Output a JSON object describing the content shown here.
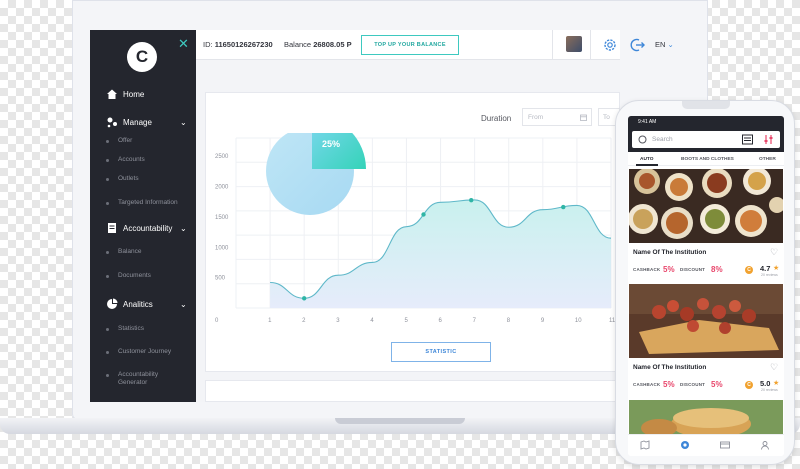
{
  "sidebar": {
    "logo_letter": "C",
    "close": "✕",
    "items": [
      {
        "label": "Home",
        "type": "main"
      },
      {
        "label": "Manage",
        "type": "main"
      },
      {
        "label": "Offer",
        "type": "sub"
      },
      {
        "label": "Accounts",
        "type": "sub"
      },
      {
        "label": "Outlets",
        "type": "sub"
      },
      {
        "label": "Targeted Information",
        "type": "sub"
      },
      {
        "label": "Accountability",
        "type": "main"
      },
      {
        "label": "Balance",
        "type": "sub"
      },
      {
        "label": "Documents",
        "type": "sub"
      },
      {
        "label": "Analitics",
        "type": "main"
      },
      {
        "label": "Statistics",
        "type": "sub"
      },
      {
        "label": "Customer Journey",
        "type": "sub"
      },
      {
        "label": "Accountability Generator",
        "type": "sub"
      }
    ]
  },
  "topbar": {
    "id_label": "ID:",
    "id_value": "11650126267230",
    "balance_label": "Balance",
    "balance_value": "26808.05 P",
    "topup_label": "TOP UP YOUR BALANCE",
    "language": "EN"
  },
  "filters": {
    "duration_label": "Duration",
    "from_placeholder": "From",
    "to_placeholder": "To"
  },
  "statistic_button": "STATISTIC",
  "chart_data": {
    "type": "area",
    "x": [
      1,
      2,
      3,
      4,
      5,
      6,
      7,
      8,
      9,
      10,
      11
    ],
    "x_ticks": [
      "0",
      "1",
      "2",
      "3",
      "4",
      "5",
      "6",
      "7",
      "8",
      "9",
      "10",
      "11"
    ],
    "y_ticks": [
      "500",
      "1000",
      "1500",
      "2000",
      "2500"
    ],
    "values": [
      420,
      160,
      540,
      750,
      1340,
      1740,
      1780,
      1330,
      1620,
      1690,
      1150
    ],
    "highlighted_points": [
      2,
      5.5,
      6.9,
      9.6
    ],
    "ylim": [
      0,
      2800
    ],
    "pie": {
      "label": "25%",
      "value": 25
    },
    "colors": {
      "line": "#5fb8c9",
      "fill_top": "#c9f1ee",
      "fill_bottom": "#e6ecfb",
      "pie_main": "#a7d9f2",
      "pie_slice": "#34d3b8"
    }
  },
  "phone": {
    "time": "9:41 AM",
    "search_placeholder": "Search",
    "tabs": [
      "AUTO",
      "BOOTS AND CLOTHES",
      "OTHER"
    ],
    "listings": [
      {
        "name": "Name Of The Institution",
        "cashback_label": "CASHBACK",
        "cashback": "5%",
        "discount_label": "DISCOUNT",
        "discount": "8%",
        "rating": "4.7",
        "badge": "C",
        "reviews": "20 reviews"
      },
      {
        "name": "Name Of The Institution",
        "cashback_label": "CASHBACK",
        "cashback": "5%",
        "discount_label": "DISCOUNT",
        "discount": "5%",
        "rating": "5.0",
        "badge": "C",
        "reviews": "20 reviews"
      }
    ]
  },
  "colors": {
    "accent": "#3ec9c0",
    "sidebar_bg": "#24262e",
    "alert": "#e8466b",
    "star": "#f1a22f"
  }
}
